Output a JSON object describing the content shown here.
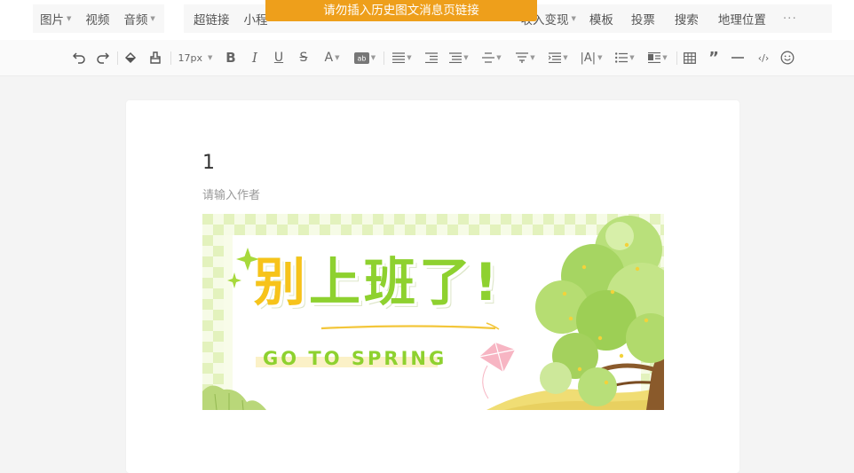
{
  "insert_toolbar": {
    "group1": [
      {
        "label": "图片",
        "has_menu": true
      },
      {
        "label": "视频",
        "has_menu": false
      },
      {
        "label": "音频",
        "has_menu": true
      }
    ],
    "group2": [
      {
        "label": "超链接",
        "has_menu": false
      },
      {
        "label": "小程",
        "has_menu": false
      },
      {
        "label": "收入变现",
        "has_menu": true
      },
      {
        "label": "模板",
        "has_menu": false
      },
      {
        "label": "投票",
        "has_menu": false
      },
      {
        "label": "搜索",
        "has_menu": false
      },
      {
        "label": "地理位置",
        "has_menu": false
      }
    ],
    "more_label": "···"
  },
  "toast": {
    "message": "请勿插入历史图文消息页链接"
  },
  "format_toolbar": {
    "font_size": "17px"
  },
  "editor": {
    "title": "1",
    "author_placeholder": "请输入作者"
  },
  "banner": {
    "headline": "别上班了!",
    "subtitle": "GO TO SPRING",
    "colors": {
      "yellow": "#f7c31a",
      "green": "#8ed12f",
      "bg": "#ffffff"
    }
  }
}
